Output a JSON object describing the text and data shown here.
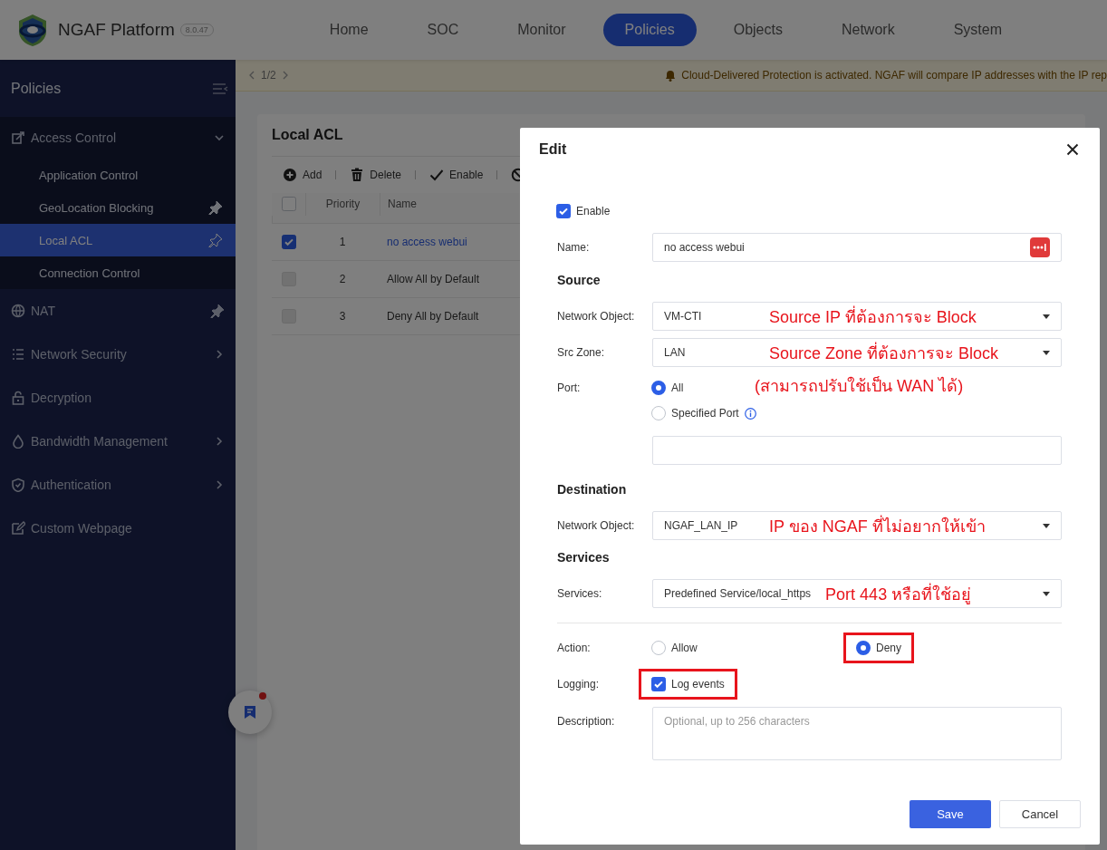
{
  "header": {
    "product": "NGAF Platform",
    "version": "8.0.47",
    "nav": [
      {
        "label": "Home",
        "selected": false
      },
      {
        "label": "SOC",
        "selected": false
      },
      {
        "label": "Monitor",
        "selected": false
      },
      {
        "label": "Policies",
        "selected": true
      },
      {
        "label": "Objects",
        "selected": false
      },
      {
        "label": "Network",
        "selected": false
      },
      {
        "label": "System",
        "selected": false
      }
    ]
  },
  "sidebar": {
    "title": "Policies",
    "items": [
      {
        "label": "Access Control",
        "expanded": true,
        "children": [
          {
            "label": "Application Control",
            "selected": false
          },
          {
            "label": "GeoLocation Blocking",
            "selected": false,
            "pinned": true
          },
          {
            "label": "Local ACL",
            "selected": true,
            "pinned": false
          },
          {
            "label": "Connection Control",
            "selected": false
          }
        ]
      },
      {
        "label": "NAT",
        "pinned": true
      },
      {
        "label": "Network Security",
        "expanded": false
      },
      {
        "label": "Decryption"
      },
      {
        "label": "Bandwidth Management",
        "expanded": false
      },
      {
        "label": "Authentication",
        "expanded": false
      },
      {
        "label": "Custom Webpage"
      }
    ]
  },
  "pager": {
    "page": "1/2"
  },
  "notice": {
    "text": "Cloud-Delivered Protection is activated. NGAF will compare IP addresses with the IP rep"
  },
  "card": {
    "title": "Local ACL",
    "toolbar": [
      {
        "kind": "add",
        "label": "Add"
      },
      {
        "kind": "delete",
        "label": "Delete"
      },
      {
        "kind": "enable",
        "label": "Enable"
      },
      {
        "kind": "disable"
      }
    ],
    "table": {
      "select_all": {
        "checked": false
      },
      "columns": [
        "Priority",
        "Name"
      ],
      "rows": [
        {
          "checked": true,
          "disabled": false,
          "priority": "1",
          "name": "no access webui"
        },
        {
          "checked": false,
          "disabled": true,
          "priority": "2",
          "name": "Allow All by Default"
        },
        {
          "checked": false,
          "disabled": true,
          "priority": "3",
          "name": "Deny All by Default"
        }
      ]
    }
  },
  "dialog": {
    "title": "Edit",
    "enable": {
      "label": "Enable",
      "checked": true
    },
    "name": {
      "label": "Name:",
      "value": "no access webui"
    },
    "source": {
      "heading": "Source",
      "network_object": {
        "label": "Network Object:",
        "value": "VM-CTI",
        "note": "Source IP ที่ต้องการจะ Block"
      },
      "src_zone": {
        "label": "Src Zone:",
        "value": "LAN",
        "note": "Source Zone ที่ต้องการจะ Block"
      },
      "port": {
        "label": "Port:",
        "note": "(สามารถปรับใช้เป็น WAN ได้)",
        "options": [
          {
            "label": "All",
            "selected": true
          },
          {
            "label": "Specified Port",
            "selected": false
          }
        ]
      }
    },
    "destination": {
      "heading": "Destination",
      "network_object": {
        "label": "Network Object:",
        "value": "NGAF_LAN_IP",
        "note": "IP ของ NGAF ที่ไม่อยากให้เข้า"
      }
    },
    "services": {
      "heading": "Services",
      "services": {
        "label": "Services:",
        "value": "Predefined Service/local_https",
        "note": "Port 443 หรือที่ใช้อยู่"
      }
    },
    "action": {
      "label": "Action:",
      "options": [
        {
          "label": "Allow",
          "selected": false,
          "highlighted": false
        },
        {
          "label": "Deny",
          "selected": true,
          "highlighted": true
        }
      ]
    },
    "logging": {
      "label": "Logging:",
      "option": {
        "label": "Log events",
        "checked": true,
        "highlighted": true
      }
    },
    "description": {
      "label": "Description:",
      "placeholder": "Optional, up to 256 characters"
    },
    "buttons": [
      {
        "label": "Save",
        "kind": "primary"
      },
      {
        "label": "Cancel",
        "kind": "secondary"
      }
    ]
  }
}
